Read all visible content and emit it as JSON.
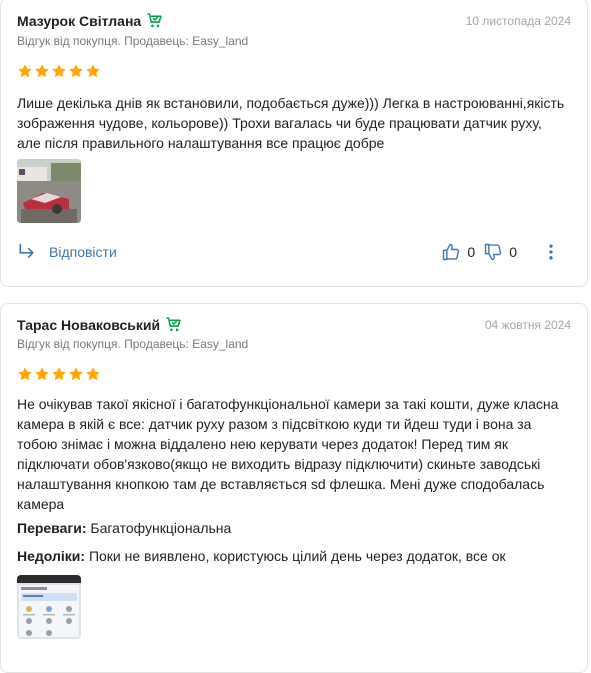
{
  "colors": {
    "star": "#ffa900",
    "link": "#3e77aa",
    "seller_icon": "#00a046"
  },
  "reviews": [
    {
      "author": "Мазурок Світлана",
      "date": "10 листопада 2024",
      "meta": "Відгук від покупця. Продавець: Easy_land",
      "rating": 5,
      "text": "Лише декілька днів як встановили, подобається дуже))) Легка в настроюванні,якість зображення чудове, кольорове)) Трохи вагалась чи буде працювати датчик руху, але після правильного налаштування все працює добре",
      "reply_label": "Відповісти",
      "likes": "0",
      "dislikes": "0"
    },
    {
      "author": "Тарас Новаковський",
      "date": "04 жовтня 2024",
      "meta": "Відгук від покупця. Продавець: Easy_land",
      "rating": 5,
      "text": "Не очікував такої якісної і багатофункціональної камери за такі кошти, дуже класна камера в якій є все: датчик руху разом з підсвіткою куди ти йдеш туди і вона за тобою знімає і можна віддалено нею керувати через додаток! Перед тим як підключати обов'язково(якщо не виходить відразу підключити) скиньте заводські налаштування кнопкою там де вставляється sd флешка. Мені дуже сподобалась камера",
      "pros_label": "Переваги:",
      "pros": "Багатофункціональна",
      "cons_label": "Недоліки:",
      "cons": "Поки не виявлено, користуюсь цілий день через додаток, все ок"
    }
  ]
}
